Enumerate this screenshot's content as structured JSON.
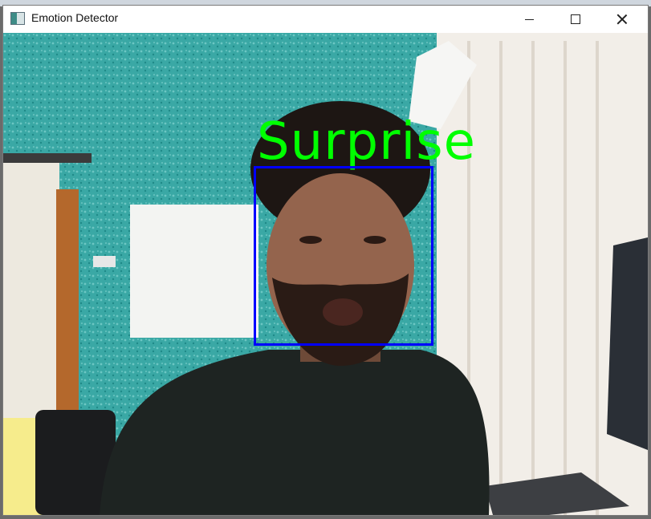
{
  "window": {
    "title": "Emotion Detector",
    "icons": {
      "app": "app-icon",
      "minimize": "minimize-icon",
      "maximize": "maximize-icon",
      "close": "close-icon"
    }
  },
  "detection": {
    "emotion": "Surprise",
    "label_color": "#00ff00",
    "box_color": "#0000ff"
  }
}
